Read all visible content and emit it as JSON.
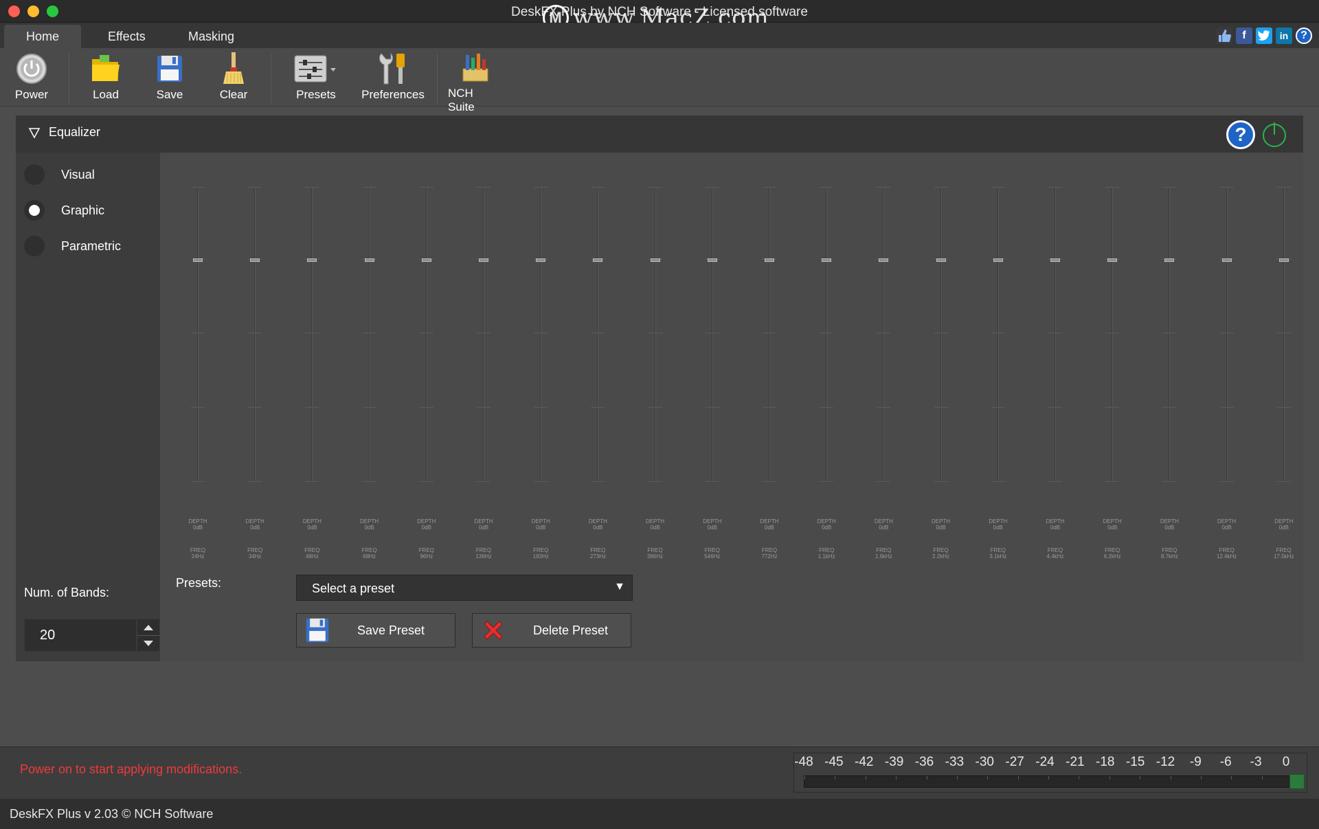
{
  "window": {
    "title": "DeskFX Plus by NCH Software - Licensed software"
  },
  "watermark": {
    "text": "www.MacZ.com",
    "logo_letter": "M"
  },
  "tabs": [
    {
      "label": "Home",
      "active": true
    },
    {
      "label": "Effects",
      "active": false
    },
    {
      "label": "Masking",
      "active": false
    }
  ],
  "social_icons": [
    "thumbs-up-icon",
    "facebook-icon",
    "twitter-icon",
    "linkedin-icon",
    "help-icon"
  ],
  "toolbar": {
    "power_label": "Power",
    "load_label": "Load",
    "save_label": "Save",
    "clear_label": "Clear",
    "presets_label": "Presets",
    "preferences_label": "Preferences",
    "nch_suite_label": "NCH Suite"
  },
  "equalizer": {
    "title": "Equalizer",
    "modes": [
      {
        "label": "Visual",
        "selected": false
      },
      {
        "label": "Graphic",
        "selected": true
      },
      {
        "label": "Parametric",
        "selected": false
      }
    ],
    "num_bands_label": "Num. of Bands:",
    "num_bands_value": "20",
    "depth_caption": "DEPTH",
    "freq_caption": "FREQ",
    "bands": [
      {
        "depth": "0dB",
        "freq": "24Hz"
      },
      {
        "depth": "0dB",
        "freq": "34Hz"
      },
      {
        "depth": "0dB",
        "freq": "48Hz"
      },
      {
        "depth": "0dB",
        "freq": "68Hz"
      },
      {
        "depth": "0dB",
        "freq": "96Hz"
      },
      {
        "depth": "0dB",
        "freq": "136Hz"
      },
      {
        "depth": "0dB",
        "freq": "193Hz"
      },
      {
        "depth": "0dB",
        "freq": "273Hz"
      },
      {
        "depth": "0dB",
        "freq": "386Hz"
      },
      {
        "depth": "0dB",
        "freq": "546Hz"
      },
      {
        "depth": "0dB",
        "freq": "772Hz"
      },
      {
        "depth": "0dB",
        "freq": "1.1kHz"
      },
      {
        "depth": "0dB",
        "freq": "1.6kHz"
      },
      {
        "depth": "0dB",
        "freq": "2.2kHz"
      },
      {
        "depth": "0dB",
        "freq": "3.1kHz"
      },
      {
        "depth": "0dB",
        "freq": "4.4kHz"
      },
      {
        "depth": "0dB",
        "freq": "6.2kHz"
      },
      {
        "depth": "0dB",
        "freq": "8.7kHz"
      },
      {
        "depth": "0dB",
        "freq": "12.4kHz"
      },
      {
        "depth": "0dB",
        "freq": "17.5kHz"
      }
    ],
    "presets_label": "Presets:",
    "preset_select_value": "Select a preset",
    "save_preset_label": "Save Preset",
    "delete_preset_label": "Delete Preset"
  },
  "status": {
    "message": "Power on to start applying modifications.",
    "meter_scale": [
      "-48",
      "-45",
      "-42",
      "-39",
      "-36",
      "-33",
      "-30",
      "-27",
      "-24",
      "-21",
      "-18",
      "-15",
      "-12",
      "-9",
      "-6",
      "-3",
      "0"
    ]
  },
  "footer": {
    "text": "DeskFX Plus v 2.03 © NCH Software"
  },
  "colors": {
    "status_error": "#f03a3a",
    "power_green": "#2db34a",
    "help_blue": "#1d64c5",
    "meter_clip_green": "#2c7a3c"
  }
}
